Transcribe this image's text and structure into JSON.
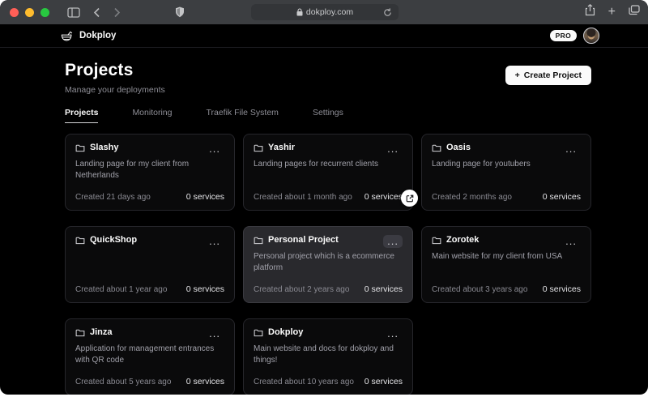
{
  "browser": {
    "url": "dokploy.com",
    "traffic_colors": {
      "close": "#ff5f57",
      "minimize": "#febc2e",
      "zoom": "#28c840"
    }
  },
  "navbar": {
    "brand": "Dokploy",
    "plan_badge": "PRO"
  },
  "page": {
    "title": "Projects",
    "subtitle": "Manage your deployments",
    "create_button_label": "Create Project",
    "create_button_plus": "+"
  },
  "tabs": [
    {
      "label": "Projects",
      "active": true
    },
    {
      "label": "Monitoring",
      "active": false
    },
    {
      "label": "Traefik File System",
      "active": false
    },
    {
      "label": "Settings",
      "active": false
    }
  ],
  "menu_glyph": "...",
  "projects": [
    {
      "name": "Slashy",
      "description": "Landing page for my client from Netherlands",
      "created": "Created 21 days ago",
      "services": "0 services"
    },
    {
      "name": "Yashir",
      "description": "Landing pages for recurrent clients",
      "created": "Created about 1 month ago",
      "services": "0 services"
    },
    {
      "name": "Oasis",
      "description": "Landing page for youtubers",
      "created": "Created 2 months ago",
      "services": "0 services"
    },
    {
      "name": "QuickShop",
      "description": "",
      "created": "Created about 1 year ago",
      "services": "0 services"
    },
    {
      "name": "Personal Project",
      "description": "Personal project which is a ecommerce platform",
      "created": "Created about 2 years ago",
      "services": "0 services",
      "highlighted": true
    },
    {
      "name": "Zorotek",
      "description": "Main website for my client from USA",
      "created": "Created about 3 years ago",
      "services": "0 services"
    },
    {
      "name": "Jinza",
      "description": "Application for management entrances with QR code",
      "created": "Created about 5 years ago",
      "services": "0 services"
    },
    {
      "name": "Dokploy",
      "description": "Main website and docs for dokploy and things!",
      "created": "Created about 10 years ago",
      "services": "0 services"
    }
  ],
  "colors": {
    "chrome_bg": "#3c3e41",
    "page_bg": "#000000",
    "card_bg": "#0a0a0b",
    "card_border": "#26262b",
    "card_highlight_bg": "#29292d",
    "accent_text": "#fafafa",
    "muted_text": "#8e8e96"
  }
}
